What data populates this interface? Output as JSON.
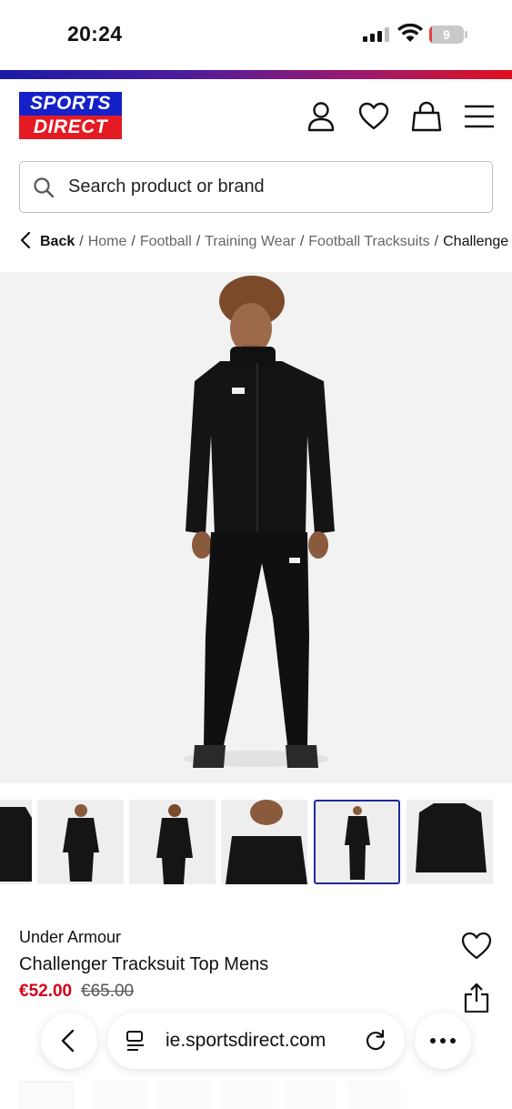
{
  "status_bar": {
    "time": "20:24",
    "battery_level": "9"
  },
  "header": {
    "logo_line1": "SPORTS",
    "logo_line2": "DIRECT"
  },
  "search": {
    "placeholder": "Search product or brand"
  },
  "breadcrumb": {
    "back": "Back",
    "items": [
      "Home",
      "Football",
      "Training Wear",
      "Football Tracksuits"
    ],
    "current": "Challenge",
    "separator": "/"
  },
  "product": {
    "brand": "Under Armour",
    "name": "Challenger Tracksuit Top Mens",
    "price": "€52.00",
    "original_price": "€65.00"
  },
  "thumbnails": {
    "count_visible": 6,
    "selected_index": 4
  },
  "browser": {
    "url": "ie.sportsdirect.com"
  },
  "colors": {
    "brand_blue": "#1420c8",
    "brand_red": "#e41b23",
    "sale_red": "#d0021b",
    "selected_border": "#1c2a9e"
  }
}
